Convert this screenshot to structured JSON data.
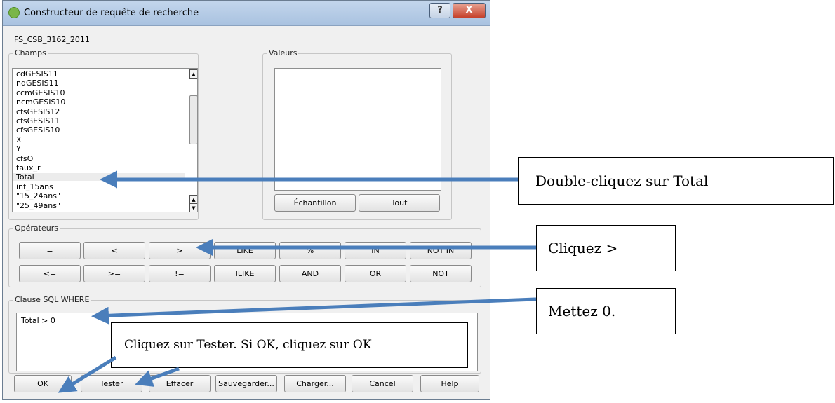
{
  "window": {
    "title": "Constructeur de requête de recherche",
    "help_symbol": "?",
    "close_symbol": "X",
    "icon": "qgis-icon"
  },
  "layer_name": "FS_CSB_3162_2011",
  "fields": {
    "legend": "Champs",
    "items": [
      "cdGESIS11",
      "ndGESIS11",
      "ccmGESIS10",
      "ncmGESIS10",
      "cfsGESIS12",
      "cfsGESIS11",
      "cfsGESIS10",
      "X",
      "Y",
      "cfsO",
      "taux_r",
      "Total",
      "inf_15ans",
      "\"15_24ans\"",
      "\"25_49ans\""
    ],
    "highlighted": "Total"
  },
  "values": {
    "legend": "Valeurs",
    "sample_button": "Échantillon",
    "all_button": "Tout"
  },
  "operators": {
    "legend": "Opérateurs",
    "row1": [
      "=",
      "<",
      ">",
      "LIKE",
      "%",
      "IN",
      "NOT IN"
    ],
    "row2": [
      "<=",
      ">=",
      "!=",
      "ILIKE",
      "AND",
      "OR",
      "NOT"
    ]
  },
  "where": {
    "legend": "Clause SQL WHERE",
    "text": "Total > 0"
  },
  "buttons": {
    "ok": "OK",
    "test": "Tester",
    "clear": "Effacer",
    "save": "Sauvegarder...",
    "load": "Charger...",
    "cancel": "Cancel",
    "help": "Help"
  },
  "callouts": {
    "total": "Double-cliquez sur Total",
    "greater": "Cliquez >",
    "zero": "Mettez 0.",
    "test": "Cliquez sur Tester. Si OK, cliquez sur OK"
  },
  "colors": {
    "arrow": "#4a7ebb",
    "titlebar": "#b7cde8",
    "close": "#c6412b"
  }
}
